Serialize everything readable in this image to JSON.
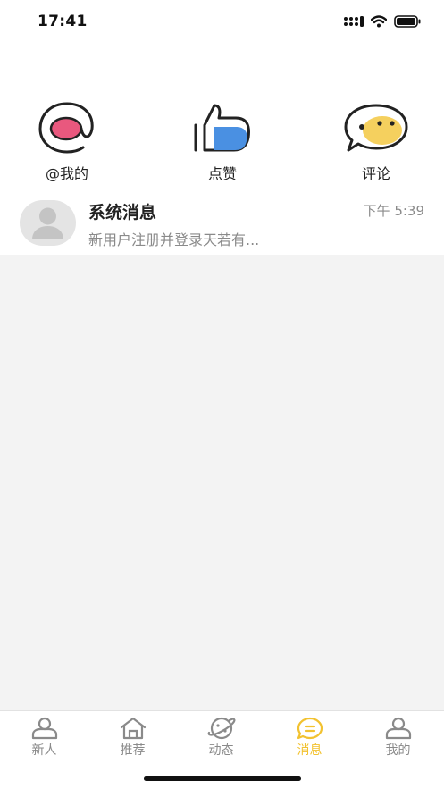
{
  "status_bar": {
    "time": "17:41",
    "icons": [
      "signal-icon",
      "wifi-icon",
      "battery-icon"
    ]
  },
  "categories": [
    {
      "id": "mention",
      "label": "@我的",
      "icon": "at-sign-icon"
    },
    {
      "id": "like",
      "label": "点赞",
      "icon": "thumbs-up-icon"
    },
    {
      "id": "comment",
      "label": "评论",
      "icon": "chat-bubble-face-icon"
    }
  ],
  "messages": [
    {
      "title": "系统消息",
      "time": "下午 5:39",
      "preview": "新用户注册并登录天若有...",
      "avatar": "default-avatar-icon"
    }
  ],
  "tabbar": {
    "tabs": [
      {
        "label": "新人",
        "icon": "person-icon",
        "active": false
      },
      {
        "label": "推荐",
        "icon": "home-icon",
        "active": false
      },
      {
        "label": "动态",
        "icon": "planet-icon",
        "active": false
      },
      {
        "label": "消息",
        "icon": "message-icon",
        "active": true
      },
      {
        "label": "我的",
        "icon": "profile-icon",
        "active": false
      }
    ]
  },
  "colors": {
    "accent": "#f2c230",
    "pink": "#e9587e",
    "blue": "#4a90e2",
    "yellow": "#f5d05e",
    "text_secondary": "#8a8a8a",
    "background": "#f3f3f3"
  }
}
